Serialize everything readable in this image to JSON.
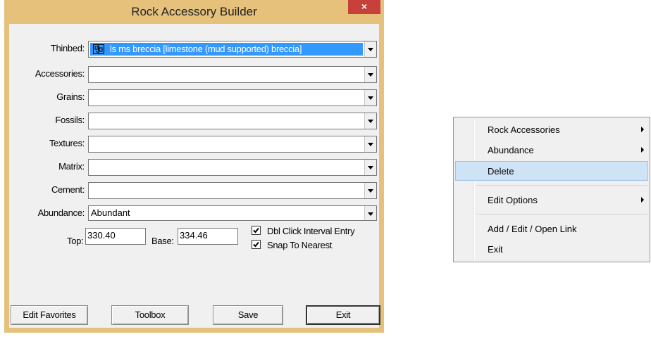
{
  "window": {
    "title": "Rock Accessory Builder",
    "close_label": "×"
  },
  "form": {
    "thinbed": {
      "label": "Thinbed:",
      "value": "ls ms breccia [limestone (mud supported) breccia]"
    },
    "accessories": {
      "label": "Accessories:",
      "value": ""
    },
    "grains": {
      "label": "Grains:",
      "value": ""
    },
    "fossils": {
      "label": "Fossils:",
      "value": ""
    },
    "textures": {
      "label": "Textures:",
      "value": ""
    },
    "matrix": {
      "label": "Matrix:",
      "value": ""
    },
    "cement": {
      "label": "Cement:",
      "value": ""
    },
    "abundance": {
      "label": "Abundance:",
      "value": "Abundant"
    },
    "top": {
      "label": "Top:",
      "value": "330.40"
    },
    "base": {
      "label": "Base:",
      "value": "334.46"
    },
    "dbl_click": {
      "label": "Dbl Click Interval Entry",
      "checked": true
    },
    "snap": {
      "label": "Snap To Nearest",
      "checked": true
    }
  },
  "buttons": {
    "edit_favorites": "Edit Favorites",
    "toolbox": "Toolbox",
    "save": "Save",
    "exit": "Exit"
  },
  "context_menu": {
    "items": [
      {
        "label": "Rock Accessories",
        "has_submenu": true
      },
      {
        "label": "Abundance",
        "has_submenu": true
      },
      {
        "label": "Delete",
        "highlighted": true
      },
      {
        "label": "Edit Options",
        "has_submenu": true
      },
      {
        "label": "Add / Edit / Open Link"
      },
      {
        "label": "Exit"
      }
    ]
  },
  "colors": {
    "title_bar": "#e5c17b",
    "close_button": "#c7403a",
    "selection": "#3399ff",
    "menu_highlight": "#cfe3f6"
  }
}
